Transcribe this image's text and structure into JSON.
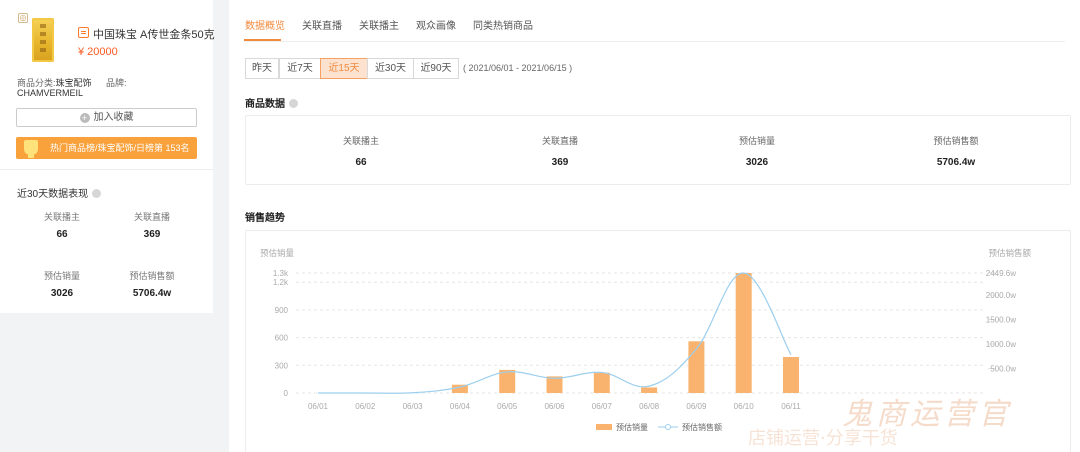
{
  "product": {
    "name": "中国珠宝 A传世金条50克",
    "price": "¥ 20000",
    "category_label": "商品分类:",
    "category_value": "珠宝配饰",
    "brand_label": "品牌:",
    "brand_value": "CHAMVERMEIL",
    "fav_button": "加入收藏",
    "fav_icon": "plus-circle-icon",
    "rank_text": "热门商品榜/珠宝配饰/日榜第 153名",
    "rank_icon": "trophy-icon"
  },
  "summary30": {
    "title": "近30天数据表现",
    "metrics": [
      {
        "label": "关联播主",
        "value": "66"
      },
      {
        "label": "关联直播",
        "value": "369"
      },
      {
        "label": "预估销量",
        "value": "3026"
      },
      {
        "label": "预估销售额",
        "value": "5706.4w"
      }
    ]
  },
  "tabs": [
    {
      "label": "数据概览",
      "active": true
    },
    {
      "label": "关联直播",
      "active": false
    },
    {
      "label": "关联播主",
      "active": false
    },
    {
      "label": "观众画像",
      "active": false
    },
    {
      "label": "同类热销商品",
      "active": false
    }
  ],
  "date_buttons": [
    {
      "label": "昨天",
      "selected": false
    },
    {
      "label": "近7天",
      "selected": false
    },
    {
      "label": "近15天",
      "selected": true
    },
    {
      "label": "近30天",
      "selected": false
    },
    {
      "label": "近90天",
      "selected": false
    }
  ],
  "date_range": "( 2021/06/01 - 2021/06/15 )",
  "product_data": {
    "title": "商品数据",
    "metrics": [
      {
        "label": "关联播主",
        "value": "66"
      },
      {
        "label": "关联直播",
        "value": "369"
      },
      {
        "label": "预估销量",
        "value": "3026"
      },
      {
        "label": "预估销售额",
        "value": "5706.4w"
      }
    ]
  },
  "trend_title": "销售趋势",
  "watermark": "鬼商运营官",
  "chart_data": {
    "type": "bar",
    "title": "",
    "left_axis_title": "预估销量",
    "right_axis_title": "预估销售额",
    "categories": [
      "06/01",
      "06/02",
      "06/03",
      "06/04",
      "06/05",
      "06/06",
      "06/07",
      "06/08",
      "06/09",
      "06/10",
      "06/11"
    ],
    "left_ticks": [
      "0",
      "300",
      "600",
      "900",
      "1.2k",
      "1.3k"
    ],
    "left_tick_values": [
      0,
      300,
      600,
      900,
      1200,
      1300
    ],
    "right_ticks": [
      "500.0w",
      "1000.0w",
      "1500.0w",
      "2000.0w",
      "2449.6w"
    ],
    "right_tick_values": [
      500,
      1000,
      1500,
      2000,
      2449.6
    ],
    "ylim_left": [
      0,
      1300
    ],
    "ylim_right": [
      0,
      2449.6
    ],
    "series": [
      {
        "name": "预估销量",
        "type": "bar",
        "color": "#f9b36f",
        "values": [
          0,
          0,
          0,
          90,
          250,
          180,
          220,
          60,
          560,
          1300,
          390
        ]
      },
      {
        "name": "预估销售额",
        "type": "line",
        "color": "#9ccfee",
        "values": [
          0,
          0,
          5,
          120,
          430,
          300,
          420,
          140,
          900,
          2449.6,
          780
        ]
      }
    ],
    "grid": true,
    "legend": "bottom-right"
  }
}
